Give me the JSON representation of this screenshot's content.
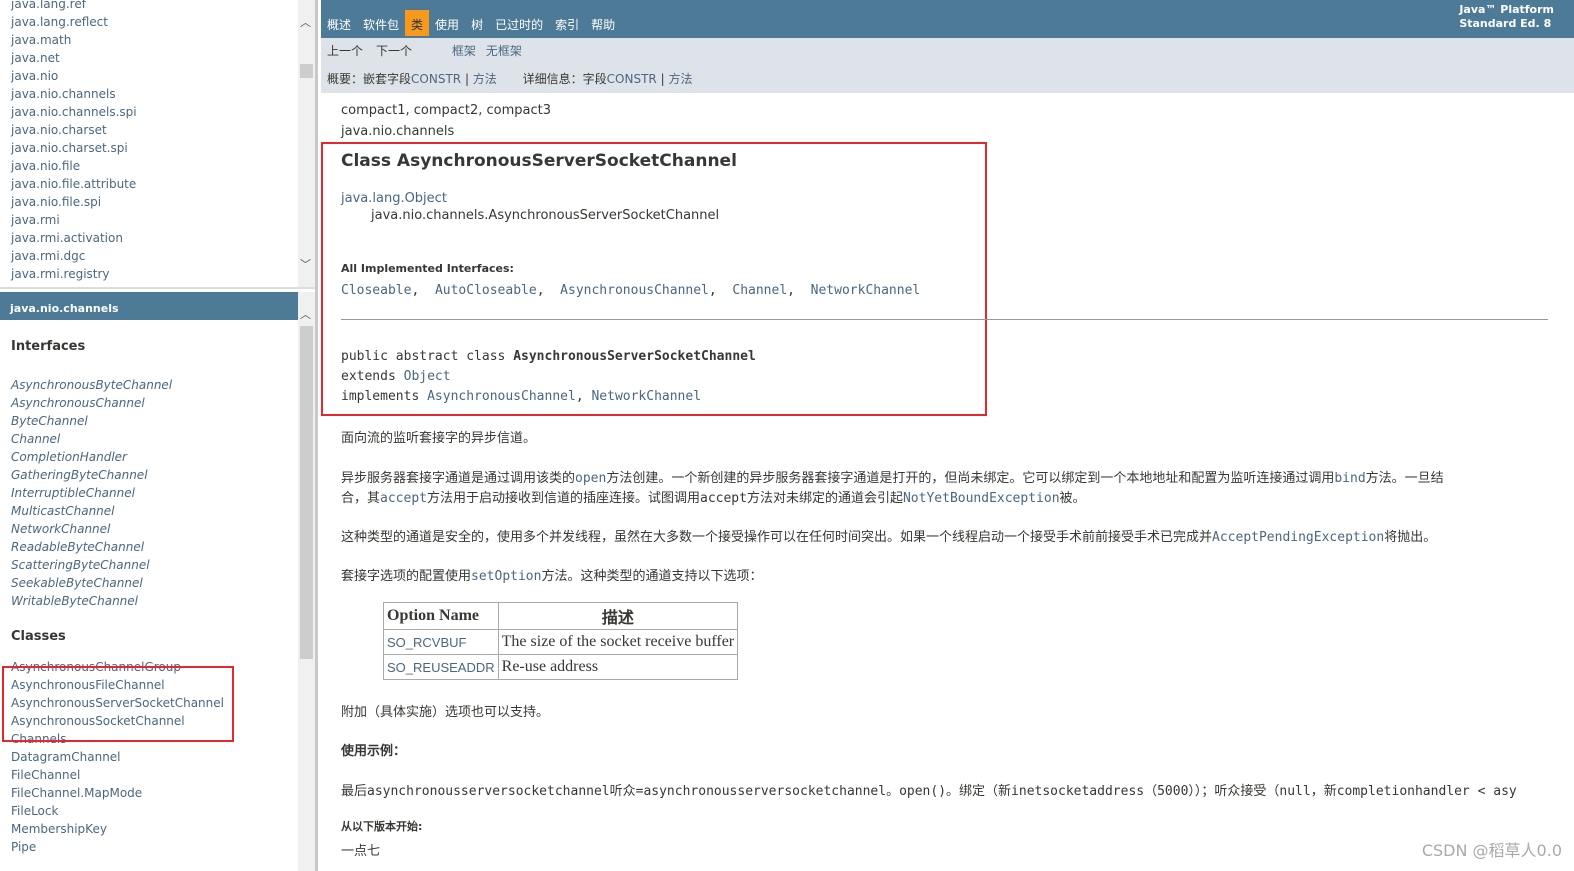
{
  "packages": [
    "java.lang.ref",
    "java.lang.reflect",
    "java.math",
    "java.net",
    "java.nio",
    "java.nio.channels",
    "java.nio.channels.spi",
    "java.nio.charset",
    "java.nio.charset.spi",
    "java.nio.file",
    "java.nio.file.attribute",
    "java.nio.file.spi",
    "java.rmi",
    "java.rmi.activation",
    "java.rmi.dgc",
    "java.rmi.registry"
  ],
  "package_frame": {
    "title": "java.nio.channels",
    "interfaces_heading": "Interfaces",
    "interfaces": [
      "AsynchronousByteChannel",
      "AsynchronousChannel",
      "ByteChannel",
      "Channel",
      "CompletionHandler",
      "GatheringByteChannel",
      "InterruptibleChannel",
      "MulticastChannel",
      "NetworkChannel",
      "ReadableByteChannel",
      "ScatteringByteChannel",
      "SeekableByteChannel",
      "WritableByteChannel"
    ],
    "classes_heading": "Classes",
    "classes": [
      "AsynchronousChannelGroup",
      "AsynchronousFileChannel",
      "AsynchronousServerSocketChannel",
      "AsynchronousSocketChannel",
      "Channels",
      "DatagramChannel",
      "FileChannel",
      "FileChannel.MapMode",
      "FileLock",
      "MembershipKey",
      "Pipe"
    ]
  },
  "nav": {
    "tabs": [
      "概述",
      "软件包",
      "类",
      "使用",
      "树",
      "已过时的",
      "索引",
      "帮助"
    ],
    "active": "类",
    "platform_line1": "Java™ Platform",
    "platform_line2": "Standard Ed. 8",
    "prev": "上一个",
    "next": "下一个",
    "frames": "框架",
    "no_frames": "无框架",
    "summary_label": "概要：",
    "summary_nested": "嵌套字段",
    "summary_constr": "CONSTR",
    "summary_sep": " | ",
    "summary_method": "方法",
    "detail_label": "详细信息：",
    "detail_field": "字段",
    "detail_constr": "CONSTR",
    "detail_method": "方法"
  },
  "colors": {
    "nav_bg": "#4D7A97",
    "active_tab": "#F8981D",
    "subnav_bg": "#dee3e9",
    "highlight_box": "#e8262c",
    "link": "#4A6782"
  },
  "content": {
    "profiles": "compact1, compact2, compact3",
    "package": "java.nio.channels",
    "title": "Class AsynchronousServerSocketChannel",
    "super": "java.lang.Object",
    "self": "java.nio.channels.AsynchronousServerSocketChannel",
    "impl_heading": "All Implemented Interfaces:",
    "impl": [
      "Closeable",
      "AutoCloseable",
      "AsynchronousChannel",
      "Channel",
      "NetworkChannel"
    ],
    "sig1_pre": "public abstract class ",
    "sig1_name": "AsynchronousServerSocketChannel",
    "sig2_pre": "extends ",
    "sig2_link": "Object",
    "sig3_pre": "implements ",
    "sig3_l1": "AsynchronousChannel",
    "sig3_l2": "NetworkChannel",
    "desc": "面向流的监听套接字的异步信道。",
    "p1a": "异步服务器套接字通道是通过调用该类的",
    "p1b": "open",
    "p1c": "方法创建。一个新创建的异步服务器套接字通道是打开的，但尚未绑定。它可以绑定到一个本地地址和配置为监听连接通过调用",
    "p1d": "bind",
    "p1e": "方法。一旦结",
    "p1f": "合，其",
    "p1g": "accept",
    "p1h": "方法用于启动接收到信道的插座连接。试图调用",
    "p1i": "accept",
    "p1j": "方法对未绑定的通道会引起",
    "p1k": "NotYetBoundException",
    "p1l": "被。",
    "p2a": "这种类型的通道是安全的，使用多个并发线程，虽然在大多数一个接受操作可以在任何时间突出。如果一个线程启动一个接受手术前前接受手术已完成并",
    "p2b": "AcceptPendingException",
    "p2c": "将抛出。",
    "p3a": "套接字选项的配置使用",
    "p3b": "setOption",
    "p3c": "方法。这种类型的通道支持以下选项：",
    "table": {
      "headers": [
        "Option Name",
        "描述"
      ],
      "rows": [
        [
          "SO_RCVBUF",
          "The size of the socket receive buffer"
        ],
        [
          "SO_REUSEADDR",
          "Re-use address"
        ]
      ]
    },
    "p4": "附加（具体实施）选项也可以支持。",
    "usage_heading": "使用示例：",
    "usage": "最后asynchronousserversocketchannel听众=asynchronousserversocketchannel。open()。绑定（新inetsocketaddress（5000））；听众接受（null，新completionhandler < asy",
    "since_heading": "从以下版本开始:",
    "since": "一点七"
  },
  "watermark": "CSDN @稻草人0.0"
}
